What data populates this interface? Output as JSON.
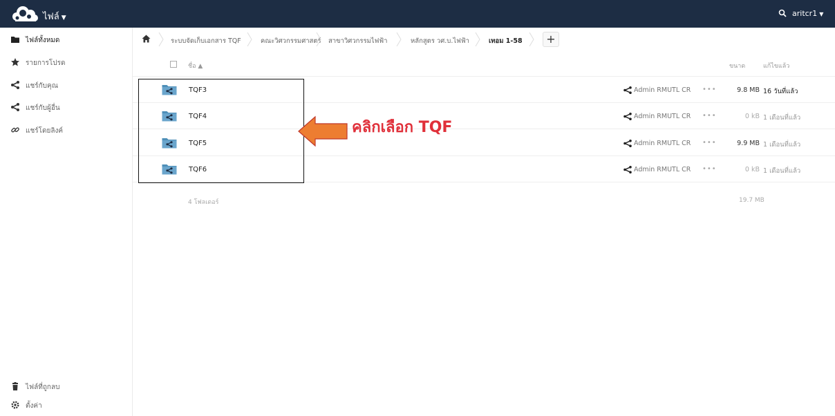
{
  "topbar": {
    "app_title": "ไฟล์",
    "user_name": "aritcr1",
    "icons": [
      "owncloud-logo",
      "search-icon",
      "caret-down-icon"
    ]
  },
  "sidebar": {
    "items": [
      {
        "label": "ไฟล์ทั้งหมด",
        "icon": "folder-icon",
        "active": true
      },
      {
        "label": "รายการโปรด",
        "icon": "star-icon",
        "active": false
      },
      {
        "label": "แชร์กับคุณ",
        "icon": "share-icon",
        "active": false
      },
      {
        "label": "แชร์กับผู้อื่น",
        "icon": "share-icon",
        "active": false
      },
      {
        "label": "แชร์โดยลิงค์",
        "icon": "link-icon",
        "active": false
      }
    ],
    "bottom": [
      {
        "label": "ไฟล์ที่ถูกลบ",
        "icon": "trash-icon"
      },
      {
        "label": "ตั้งค่า",
        "icon": "gear-icon"
      }
    ]
  },
  "breadcrumb": [
    "ระบบจัดเก็บเอกสาร TQF",
    "คณะวิศวกรรมศาสตร์",
    "สาขาวิศวกรรมไฟฟ้า",
    "หลักสูตร วศ.บ.ไฟฟ้า",
    "เทอม 1-58"
  ],
  "table": {
    "col_name": "ชื่อ ▲",
    "col_size": "ขนาด",
    "col_modified": "แก้ไขแล้ว",
    "rows": [
      {
        "name": "TQF3",
        "owner": "Admin RMUTL CR",
        "more": "•••",
        "size": "9.8 MB",
        "modified": "16 วันที่แล้ว",
        "size_light": false
      },
      {
        "name": "TQF4",
        "owner": "Admin RMUTL CR",
        "more": "•••",
        "size": "0 kB",
        "modified": "1 เดือนที่แล้ว",
        "size_light": true
      },
      {
        "name": "TQF5",
        "owner": "Admin RMUTL CR",
        "more": "•••",
        "size": "9.9 MB",
        "modified": "1 เดือนที่แล้ว",
        "size_light": false
      },
      {
        "name": "TQF6",
        "owner": "Admin RMUTL CR",
        "more": "•••",
        "size": "0 kB",
        "modified": "1 เดือนที่แล้ว",
        "size_light": true
      }
    ],
    "summary_count": "4 โฟลเดอร์",
    "summary_size": "19.7 MB"
  },
  "annotation": {
    "text_prefix": "คลิกเลือก ",
    "text_bold": "TQF",
    "arrow_color": "#ed7d31",
    "text_color": "#e0303a"
  },
  "colors": {
    "topbar": "#1d2d44",
    "folder": "#4e8fb8"
  }
}
